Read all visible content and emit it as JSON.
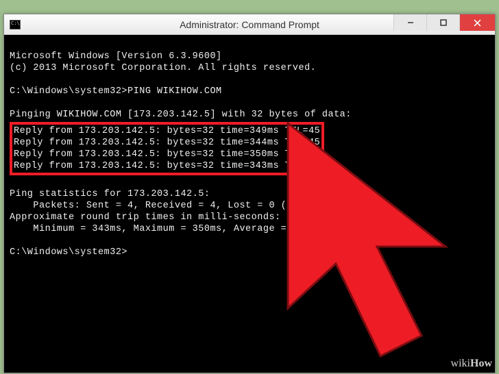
{
  "window": {
    "title": "Administrator: Command Prompt",
    "icon_text": "C:\\"
  },
  "terminal": {
    "line1": "Microsoft Windows [Version 6.3.9600]",
    "line2": "(c) 2013 Microsoft Corporation. All rights reserved.",
    "blank1": "",
    "prompt1": "C:\\Windows\\system32>PING WIKIHOW.COM",
    "blank2": "",
    "pinging_partial": "Pinging WIKIHOW.COM [173.203.142.5] with 32 bytes of data:",
    "reply1": "Reply from 173.203.142.5: bytes=32 time=349ms TTL=45",
    "reply2": "Reply from 173.203.142.5: bytes=32 time=344ms TTL=45",
    "reply3": "Reply from 173.203.142.5: bytes=32 time=350ms TTL=45",
    "reply4": "Reply from 173.203.142.5: bytes=32 time=343ms TTL=45",
    "blank3": "",
    "stats1": "Ping statistics for 173.203.142.5:",
    "stats2": "    Packets: Sent = 4, Received = 4, Lost = 0 (0% loss),",
    "stats3": "Approximate round trip times in milli-seconds:",
    "stats4": "    Minimum = 343ms, Maximum = 350ms, Average = 346ms",
    "blank4": "",
    "prompt2": "C:\\Windows\\system32>"
  },
  "watermark": {
    "prefix": "wiki",
    "suffix": "How"
  },
  "cursor_color": "#ee1c25"
}
